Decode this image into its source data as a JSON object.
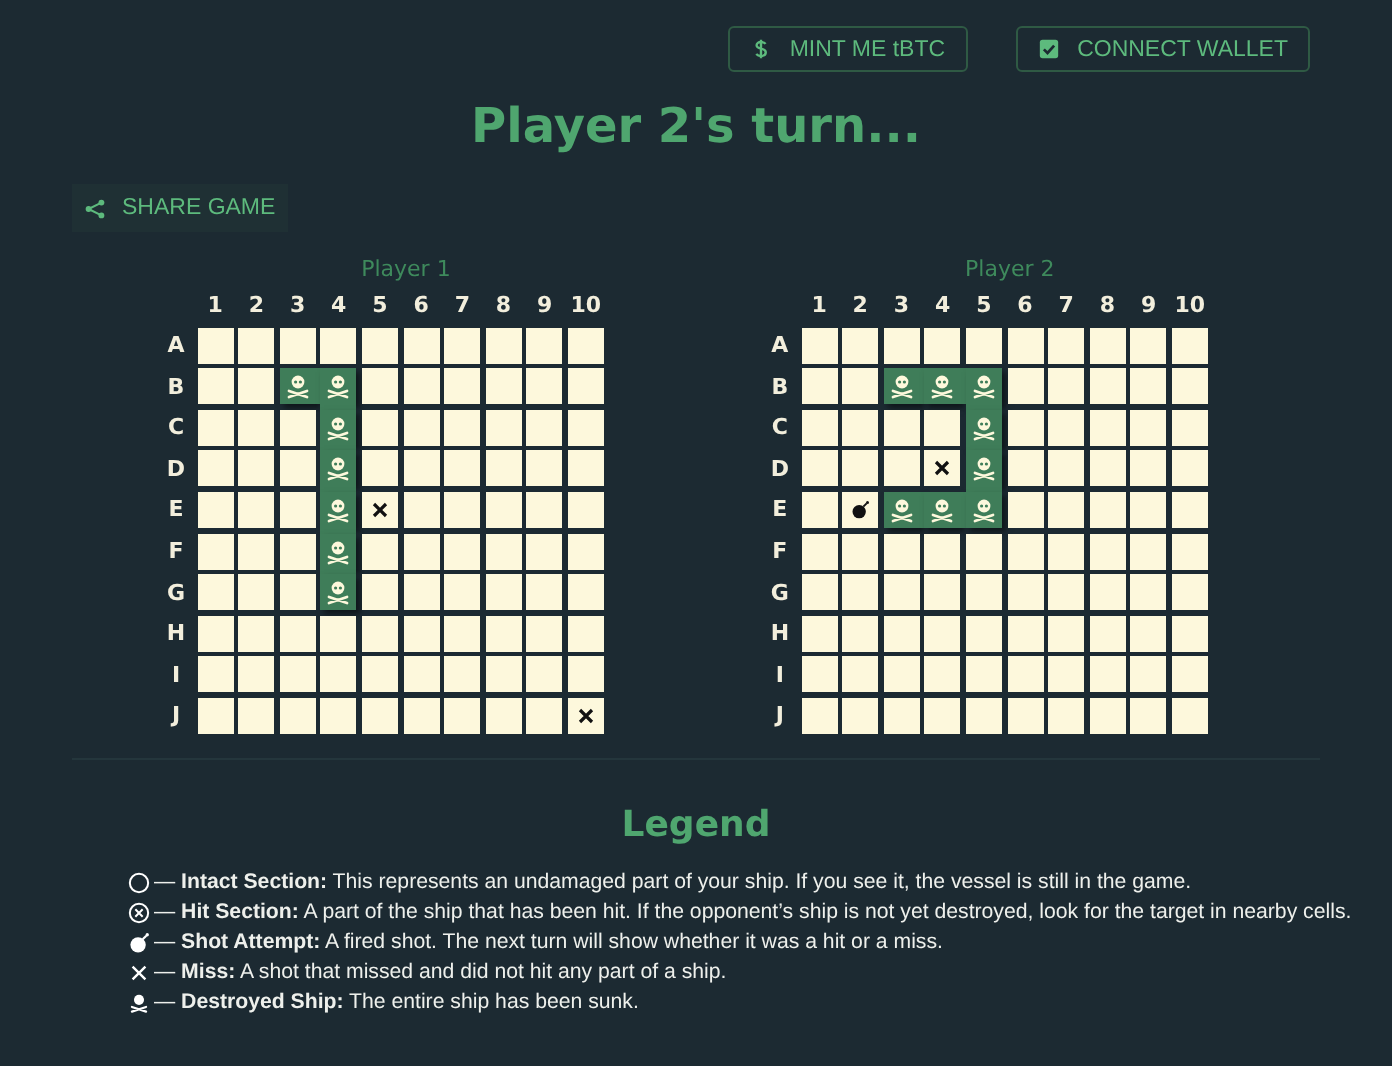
{
  "header_buttons": [
    {
      "label": "MINT ME tBTC"
    },
    {
      "label": "CONNECT WALLET"
    }
  ],
  "title": "Player 2's turn...",
  "share_button": {
    "label": "SHARE GAME"
  },
  "boards": [
    {
      "title": "Player 1",
      "column_labels": [
        "1",
        "2",
        "3",
        "4",
        "5",
        "6",
        "7",
        "8",
        "9",
        "10"
      ],
      "row_labels": [
        "A",
        "B",
        "C",
        "D",
        "E",
        "F",
        "G",
        "H",
        "I",
        "J"
      ],
      "cells": [
        [
          {
            "kind": "empty"
          },
          {
            "kind": "empty"
          },
          {
            "kind": "empty"
          },
          {
            "kind": "empty"
          },
          {
            "kind": "empty"
          },
          {
            "kind": "empty"
          },
          {
            "kind": "empty"
          },
          {
            "kind": "empty"
          },
          {
            "kind": "empty"
          },
          {
            "kind": "empty"
          }
        ],
        [
          {
            "kind": "empty"
          },
          {
            "kind": "empty"
          },
          {
            "kind": "sunk"
          },
          {
            "kind": "sunk"
          },
          {
            "kind": "empty"
          },
          {
            "kind": "empty"
          },
          {
            "kind": "empty"
          },
          {
            "kind": "empty"
          },
          {
            "kind": "empty"
          },
          {
            "kind": "empty"
          }
        ],
        [
          {
            "kind": "empty"
          },
          {
            "kind": "empty"
          },
          {
            "kind": "empty"
          },
          {
            "kind": "sunk"
          },
          {
            "kind": "empty"
          },
          {
            "kind": "empty"
          },
          {
            "kind": "empty"
          },
          {
            "kind": "empty"
          },
          {
            "kind": "empty"
          },
          {
            "kind": "empty"
          }
        ],
        [
          {
            "kind": "empty"
          },
          {
            "kind": "empty"
          },
          {
            "kind": "empty"
          },
          {
            "kind": "sunk"
          },
          {
            "kind": "empty"
          },
          {
            "kind": "empty"
          },
          {
            "kind": "empty"
          },
          {
            "kind": "empty"
          },
          {
            "kind": "empty"
          },
          {
            "kind": "empty"
          }
        ],
        [
          {
            "kind": "empty"
          },
          {
            "kind": "empty"
          },
          {
            "kind": "empty"
          },
          {
            "kind": "sunk"
          },
          {
            "kind": "miss"
          },
          {
            "kind": "empty"
          },
          {
            "kind": "empty"
          },
          {
            "kind": "empty"
          },
          {
            "kind": "empty"
          },
          {
            "kind": "empty"
          }
        ],
        [
          {
            "kind": "empty"
          },
          {
            "kind": "empty"
          },
          {
            "kind": "empty"
          },
          {
            "kind": "sunk"
          },
          {
            "kind": "empty"
          },
          {
            "kind": "empty"
          },
          {
            "kind": "empty"
          },
          {
            "kind": "empty"
          },
          {
            "kind": "empty"
          },
          {
            "kind": "empty"
          }
        ],
        [
          {
            "kind": "empty"
          },
          {
            "kind": "empty"
          },
          {
            "kind": "empty"
          },
          {
            "kind": "sunk"
          },
          {
            "kind": "empty"
          },
          {
            "kind": "empty"
          },
          {
            "kind": "empty"
          },
          {
            "kind": "empty"
          },
          {
            "kind": "empty"
          },
          {
            "kind": "empty"
          }
        ],
        [
          {
            "kind": "empty"
          },
          {
            "kind": "empty"
          },
          {
            "kind": "empty"
          },
          {
            "kind": "empty"
          },
          {
            "kind": "empty"
          },
          {
            "kind": "empty"
          },
          {
            "kind": "empty"
          },
          {
            "kind": "empty"
          },
          {
            "kind": "empty"
          },
          {
            "kind": "empty"
          }
        ],
        [
          {
            "kind": "empty"
          },
          {
            "kind": "empty"
          },
          {
            "kind": "empty"
          },
          {
            "kind": "empty"
          },
          {
            "kind": "empty"
          },
          {
            "kind": "empty"
          },
          {
            "kind": "empty"
          },
          {
            "kind": "empty"
          },
          {
            "kind": "empty"
          },
          {
            "kind": "empty"
          }
        ],
        [
          {
            "kind": "empty"
          },
          {
            "kind": "empty"
          },
          {
            "kind": "empty"
          },
          {
            "kind": "empty"
          },
          {
            "kind": "empty"
          },
          {
            "kind": "empty"
          },
          {
            "kind": "empty"
          },
          {
            "kind": "empty"
          },
          {
            "kind": "empty"
          },
          {
            "kind": "miss"
          }
        ]
      ]
    },
    {
      "title": "Player 2",
      "column_labels": [
        "1",
        "2",
        "3",
        "4",
        "5",
        "6",
        "7",
        "8",
        "9",
        "10"
      ],
      "row_labels": [
        "A",
        "B",
        "C",
        "D",
        "E",
        "F",
        "G",
        "H",
        "I",
        "J"
      ],
      "cells": [
        [
          {
            "kind": "empty"
          },
          {
            "kind": "empty"
          },
          {
            "kind": "empty"
          },
          {
            "kind": "empty"
          },
          {
            "kind": "empty"
          },
          {
            "kind": "empty"
          },
          {
            "kind": "empty"
          },
          {
            "kind": "empty"
          },
          {
            "kind": "empty"
          },
          {
            "kind": "empty"
          }
        ],
        [
          {
            "kind": "empty"
          },
          {
            "kind": "empty"
          },
          {
            "kind": "sunk"
          },
          {
            "kind": "sunk"
          },
          {
            "kind": "sunk"
          },
          {
            "kind": "empty"
          },
          {
            "kind": "empty"
          },
          {
            "kind": "empty"
          },
          {
            "kind": "empty"
          },
          {
            "kind": "empty"
          }
        ],
        [
          {
            "kind": "empty"
          },
          {
            "kind": "empty"
          },
          {
            "kind": "empty"
          },
          {
            "kind": "empty"
          },
          {
            "kind": "sunk"
          },
          {
            "kind": "empty"
          },
          {
            "kind": "empty"
          },
          {
            "kind": "empty"
          },
          {
            "kind": "empty"
          },
          {
            "kind": "empty"
          }
        ],
        [
          {
            "kind": "empty"
          },
          {
            "kind": "empty"
          },
          {
            "kind": "empty"
          },
          {
            "kind": "miss"
          },
          {
            "kind": "sunk"
          },
          {
            "kind": "empty"
          },
          {
            "kind": "empty"
          },
          {
            "kind": "empty"
          },
          {
            "kind": "empty"
          },
          {
            "kind": "empty"
          }
        ],
        [
          {
            "kind": "empty"
          },
          {
            "kind": "shot"
          },
          {
            "kind": "sunk"
          },
          {
            "kind": "sunk"
          },
          {
            "kind": "sunk"
          },
          {
            "kind": "empty"
          },
          {
            "kind": "empty"
          },
          {
            "kind": "empty"
          },
          {
            "kind": "empty"
          },
          {
            "kind": "empty"
          }
        ],
        [
          {
            "kind": "empty"
          },
          {
            "kind": "empty"
          },
          {
            "kind": "empty"
          },
          {
            "kind": "empty"
          },
          {
            "kind": "empty"
          },
          {
            "kind": "empty"
          },
          {
            "kind": "empty"
          },
          {
            "kind": "empty"
          },
          {
            "kind": "empty"
          },
          {
            "kind": "empty"
          }
        ],
        [
          {
            "kind": "empty"
          },
          {
            "kind": "empty"
          },
          {
            "kind": "empty"
          },
          {
            "kind": "empty"
          },
          {
            "kind": "empty"
          },
          {
            "kind": "empty"
          },
          {
            "kind": "empty"
          },
          {
            "kind": "empty"
          },
          {
            "kind": "empty"
          },
          {
            "kind": "empty"
          }
        ],
        [
          {
            "kind": "empty"
          },
          {
            "kind": "empty"
          },
          {
            "kind": "empty"
          },
          {
            "kind": "empty"
          },
          {
            "kind": "empty"
          },
          {
            "kind": "empty"
          },
          {
            "kind": "empty"
          },
          {
            "kind": "empty"
          },
          {
            "kind": "empty"
          },
          {
            "kind": "empty"
          }
        ],
        [
          {
            "kind": "empty"
          },
          {
            "kind": "empty"
          },
          {
            "kind": "empty"
          },
          {
            "kind": "empty"
          },
          {
            "kind": "empty"
          },
          {
            "kind": "empty"
          },
          {
            "kind": "empty"
          },
          {
            "kind": "empty"
          },
          {
            "kind": "empty"
          },
          {
            "kind": "empty"
          }
        ],
        [
          {
            "kind": "empty"
          },
          {
            "kind": "empty"
          },
          {
            "kind": "empty"
          },
          {
            "kind": "empty"
          },
          {
            "kind": "empty"
          },
          {
            "kind": "empty"
          },
          {
            "kind": "empty"
          },
          {
            "kind": "empty"
          },
          {
            "kind": "empty"
          },
          {
            "kind": "empty"
          }
        ]
      ]
    }
  ],
  "legend": {
    "title": "Legend",
    "items": [
      {
        "kind": "intact",
        "text": "— **Intact Section:** This represents an undamaged part of your ship. If you see it, the vessel is still in the game."
      },
      {
        "kind": "hit",
        "text": "— **Hit Section:** A part of the ship that has been hit. If the opponent’s ship is not yet destroyed, look for the target in nearby cells."
      },
      {
        "kind": "shot",
        "text": "— **Shot Attempt:** A fired shot. The next turn will show whether it was a hit or a miss."
      },
      {
        "kind": "miss",
        "text": "— **Miss:** A shot that missed and did not hit any part of a ship."
      },
      {
        "kind": "sunk",
        "text": "— **Destroyed Ship:** The entire ship has been sunk."
      }
    ]
  }
}
